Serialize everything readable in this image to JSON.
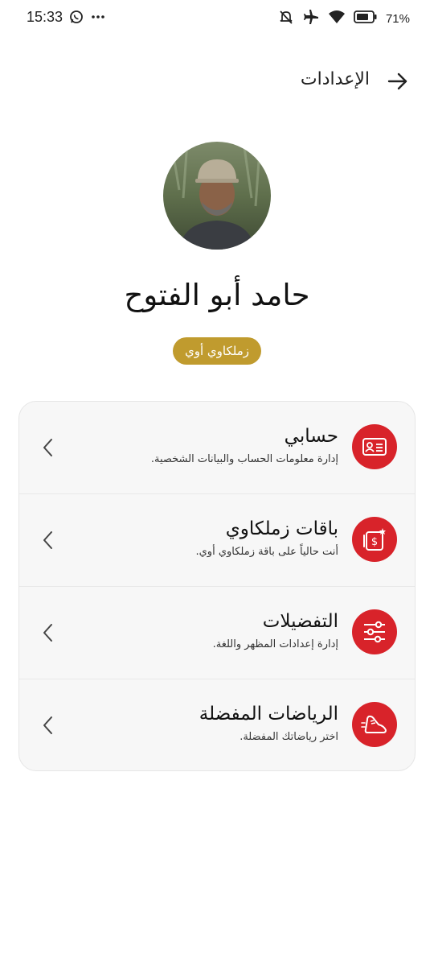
{
  "status_bar": {
    "time": "15:33",
    "battery": "71%",
    "icons": [
      "whatsapp-icon",
      "more-dots-icon",
      "mute-icon",
      "airplane-icon",
      "wifi-icon",
      "battery-icon"
    ]
  },
  "header": {
    "title": "الإعدادات",
    "back_icon": "arrow-right-icon"
  },
  "profile": {
    "name": "حامد أبو الفتوح",
    "badge": "زملكاوي أوي"
  },
  "menu": {
    "items": [
      {
        "title": "حسابي",
        "subtitle": "إدارة معلومات الحساب والبيانات الشخصية.",
        "icon": "id-card-icon"
      },
      {
        "title": "باقات زملكاوي",
        "subtitle": "أنت حالياً على باقة زملكاوي أوي.",
        "icon": "subscription-icon"
      },
      {
        "title": "التفضيلات",
        "subtitle": "إدارة إعدادات المظهر واللغة.",
        "icon": "sliders-icon"
      },
      {
        "title": "الرياضات المفضلة",
        "subtitle": "اختر رياضاتك المفضلة.",
        "icon": "sneaker-icon"
      }
    ]
  },
  "colors": {
    "accent_red": "#d8232a",
    "badge_gold": "#c09b2e",
    "card_bg": "#f7f7f7"
  }
}
